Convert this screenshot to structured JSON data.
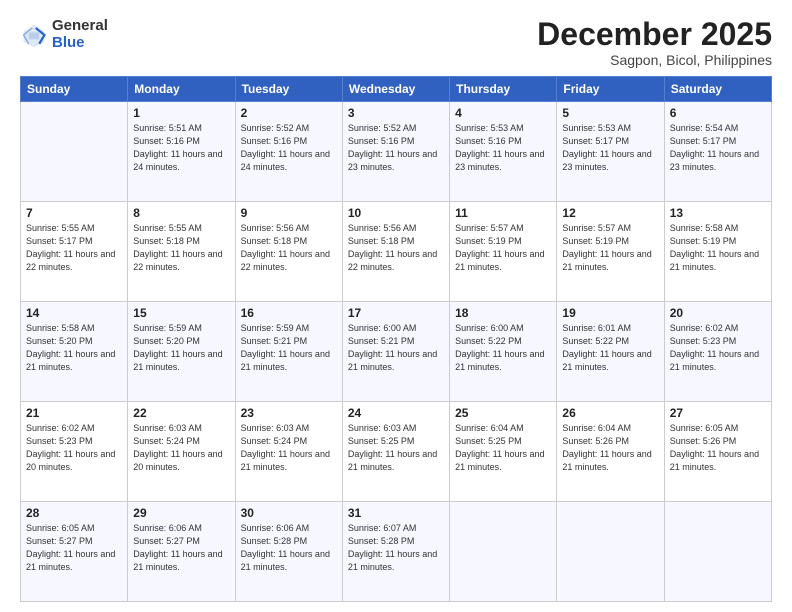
{
  "header": {
    "logo_line1": "General",
    "logo_line2": "Blue",
    "month": "December 2025",
    "location": "Sagpon, Bicol, Philippines"
  },
  "days_of_week": [
    "Sunday",
    "Monday",
    "Tuesday",
    "Wednesday",
    "Thursday",
    "Friday",
    "Saturday"
  ],
  "weeks": [
    [
      {
        "day": "",
        "sunrise": "",
        "sunset": "",
        "daylight": ""
      },
      {
        "day": "1",
        "sunrise": "Sunrise: 5:51 AM",
        "sunset": "Sunset: 5:16 PM",
        "daylight": "Daylight: 11 hours and 24 minutes."
      },
      {
        "day": "2",
        "sunrise": "Sunrise: 5:52 AM",
        "sunset": "Sunset: 5:16 PM",
        "daylight": "Daylight: 11 hours and 24 minutes."
      },
      {
        "day": "3",
        "sunrise": "Sunrise: 5:52 AM",
        "sunset": "Sunset: 5:16 PM",
        "daylight": "Daylight: 11 hours and 23 minutes."
      },
      {
        "day": "4",
        "sunrise": "Sunrise: 5:53 AM",
        "sunset": "Sunset: 5:16 PM",
        "daylight": "Daylight: 11 hours and 23 minutes."
      },
      {
        "day": "5",
        "sunrise": "Sunrise: 5:53 AM",
        "sunset": "Sunset: 5:17 PM",
        "daylight": "Daylight: 11 hours and 23 minutes."
      },
      {
        "day": "6",
        "sunrise": "Sunrise: 5:54 AM",
        "sunset": "Sunset: 5:17 PM",
        "daylight": "Daylight: 11 hours and 23 minutes."
      }
    ],
    [
      {
        "day": "7",
        "sunrise": "Sunrise: 5:55 AM",
        "sunset": "Sunset: 5:17 PM",
        "daylight": "Daylight: 11 hours and 22 minutes."
      },
      {
        "day": "8",
        "sunrise": "Sunrise: 5:55 AM",
        "sunset": "Sunset: 5:18 PM",
        "daylight": "Daylight: 11 hours and 22 minutes."
      },
      {
        "day": "9",
        "sunrise": "Sunrise: 5:56 AM",
        "sunset": "Sunset: 5:18 PM",
        "daylight": "Daylight: 11 hours and 22 minutes."
      },
      {
        "day": "10",
        "sunrise": "Sunrise: 5:56 AM",
        "sunset": "Sunset: 5:18 PM",
        "daylight": "Daylight: 11 hours and 22 minutes."
      },
      {
        "day": "11",
        "sunrise": "Sunrise: 5:57 AM",
        "sunset": "Sunset: 5:19 PM",
        "daylight": "Daylight: 11 hours and 21 minutes."
      },
      {
        "day": "12",
        "sunrise": "Sunrise: 5:57 AM",
        "sunset": "Sunset: 5:19 PM",
        "daylight": "Daylight: 11 hours and 21 minutes."
      },
      {
        "day": "13",
        "sunrise": "Sunrise: 5:58 AM",
        "sunset": "Sunset: 5:19 PM",
        "daylight": "Daylight: 11 hours and 21 minutes."
      }
    ],
    [
      {
        "day": "14",
        "sunrise": "Sunrise: 5:58 AM",
        "sunset": "Sunset: 5:20 PM",
        "daylight": "Daylight: 11 hours and 21 minutes."
      },
      {
        "day": "15",
        "sunrise": "Sunrise: 5:59 AM",
        "sunset": "Sunset: 5:20 PM",
        "daylight": "Daylight: 11 hours and 21 minutes."
      },
      {
        "day": "16",
        "sunrise": "Sunrise: 5:59 AM",
        "sunset": "Sunset: 5:21 PM",
        "daylight": "Daylight: 11 hours and 21 minutes."
      },
      {
        "day": "17",
        "sunrise": "Sunrise: 6:00 AM",
        "sunset": "Sunset: 5:21 PM",
        "daylight": "Daylight: 11 hours and 21 minutes."
      },
      {
        "day": "18",
        "sunrise": "Sunrise: 6:00 AM",
        "sunset": "Sunset: 5:22 PM",
        "daylight": "Daylight: 11 hours and 21 minutes."
      },
      {
        "day": "19",
        "sunrise": "Sunrise: 6:01 AM",
        "sunset": "Sunset: 5:22 PM",
        "daylight": "Daylight: 11 hours and 21 minutes."
      },
      {
        "day": "20",
        "sunrise": "Sunrise: 6:02 AM",
        "sunset": "Sunset: 5:23 PM",
        "daylight": "Daylight: 11 hours and 21 minutes."
      }
    ],
    [
      {
        "day": "21",
        "sunrise": "Sunrise: 6:02 AM",
        "sunset": "Sunset: 5:23 PM",
        "daylight": "Daylight: 11 hours and 20 minutes."
      },
      {
        "day": "22",
        "sunrise": "Sunrise: 6:03 AM",
        "sunset": "Sunset: 5:24 PM",
        "daylight": "Daylight: 11 hours and 20 minutes."
      },
      {
        "day": "23",
        "sunrise": "Sunrise: 6:03 AM",
        "sunset": "Sunset: 5:24 PM",
        "daylight": "Daylight: 11 hours and 21 minutes."
      },
      {
        "day": "24",
        "sunrise": "Sunrise: 6:03 AM",
        "sunset": "Sunset: 5:25 PM",
        "daylight": "Daylight: 11 hours and 21 minutes."
      },
      {
        "day": "25",
        "sunrise": "Sunrise: 6:04 AM",
        "sunset": "Sunset: 5:25 PM",
        "daylight": "Daylight: 11 hours and 21 minutes."
      },
      {
        "day": "26",
        "sunrise": "Sunrise: 6:04 AM",
        "sunset": "Sunset: 5:26 PM",
        "daylight": "Daylight: 11 hours and 21 minutes."
      },
      {
        "day": "27",
        "sunrise": "Sunrise: 6:05 AM",
        "sunset": "Sunset: 5:26 PM",
        "daylight": "Daylight: 11 hours and 21 minutes."
      }
    ],
    [
      {
        "day": "28",
        "sunrise": "Sunrise: 6:05 AM",
        "sunset": "Sunset: 5:27 PM",
        "daylight": "Daylight: 11 hours and 21 minutes."
      },
      {
        "day": "29",
        "sunrise": "Sunrise: 6:06 AM",
        "sunset": "Sunset: 5:27 PM",
        "daylight": "Daylight: 11 hours and 21 minutes."
      },
      {
        "day": "30",
        "sunrise": "Sunrise: 6:06 AM",
        "sunset": "Sunset: 5:28 PM",
        "daylight": "Daylight: 11 hours and 21 minutes."
      },
      {
        "day": "31",
        "sunrise": "Sunrise: 6:07 AM",
        "sunset": "Sunset: 5:28 PM",
        "daylight": "Daylight: 11 hours and 21 minutes."
      },
      {
        "day": "",
        "sunrise": "",
        "sunset": "",
        "daylight": ""
      },
      {
        "day": "",
        "sunrise": "",
        "sunset": "",
        "daylight": ""
      },
      {
        "day": "",
        "sunrise": "",
        "sunset": "",
        "daylight": ""
      }
    ]
  ]
}
